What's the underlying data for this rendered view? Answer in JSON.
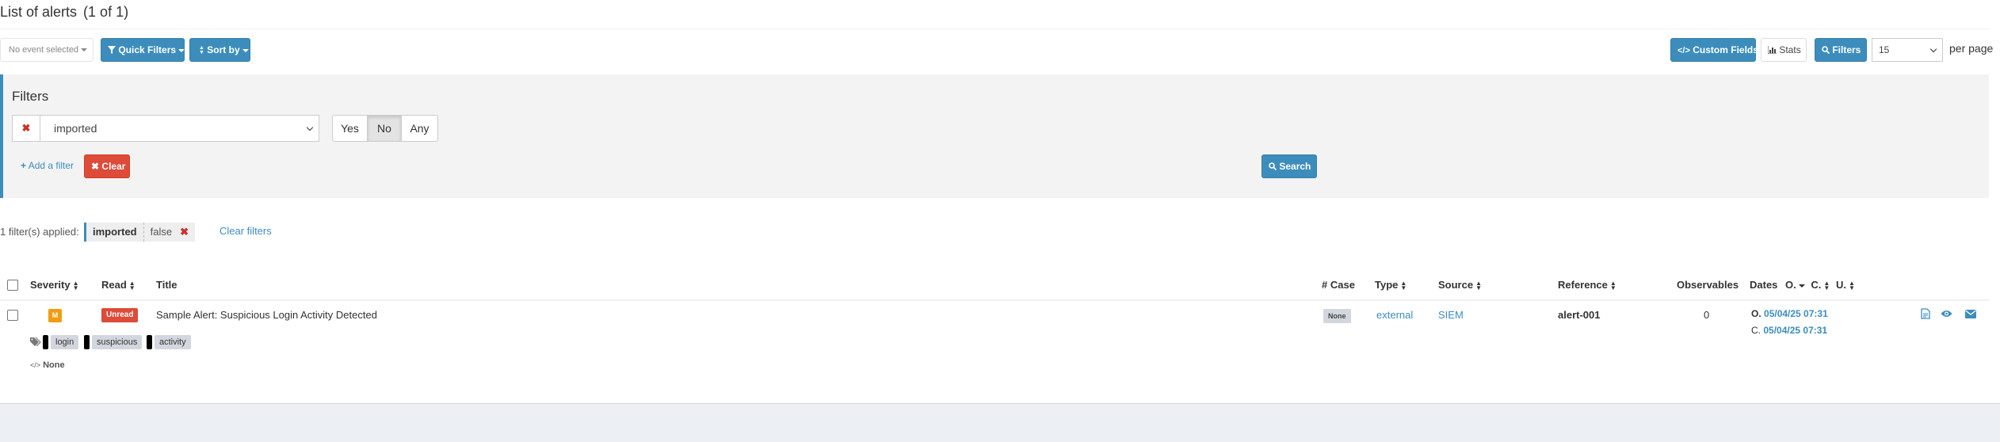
{
  "header": {
    "title": "List of alerts",
    "count": "(1 of 1)"
  },
  "toolbar": {
    "event_select": "No event selected",
    "quick_filters": "Quick Filters",
    "sort_by": "Sort by",
    "custom_fields": "Custom Fields",
    "stats": "Stats",
    "filters": "Filters",
    "per_page_value": "15",
    "per_page_label": "per page"
  },
  "filters_panel": {
    "title": "Filters",
    "field_value": "imported",
    "options": [
      "Yes",
      "No",
      "Any"
    ],
    "selected_option": "No",
    "add_filter": "Add a filter",
    "clear": "Clear",
    "search": "Search"
  },
  "applied": {
    "label": "1 filter(s) applied:",
    "chip_key": "imported",
    "chip_value": "false",
    "clear_filters": "Clear filters"
  },
  "table": {
    "columns": {
      "severity": "Severity",
      "read": "Read",
      "title": "Title",
      "case": "# Case",
      "type": "Type",
      "source": "Source",
      "reference": "Reference",
      "observables": "Observables",
      "dates": "Dates",
      "dates_o": "O.",
      "dates_c": "C.",
      "dates_u": "U."
    },
    "rows": [
      {
        "severity": "M",
        "read": "Unread",
        "title": "Sample Alert: Suspicious Login Activity Detected",
        "tags": [
          "login",
          "suspicious",
          "activity"
        ],
        "custom_fields": "None",
        "case": "None",
        "type": "external",
        "source": "SIEM",
        "reference": "alert-001",
        "observables": "0",
        "date_o_label": "O.",
        "date_o": "05/04/25 07:31",
        "date_c_label": "C.",
        "date_c": "05/04/25 07:31"
      }
    ]
  },
  "colors": {
    "primary": "#3c8dbc",
    "danger": "#dd4b39",
    "warning": "#f39c12",
    "panel_bg": "#f3f3f3"
  },
  "icons": [
    "filter-icon",
    "sort-icon",
    "code-icon",
    "bar-chart-icon",
    "search-icon",
    "plus-icon",
    "times-icon",
    "tags-icon",
    "file-icon",
    "eye-icon",
    "envelope-icon"
  ]
}
